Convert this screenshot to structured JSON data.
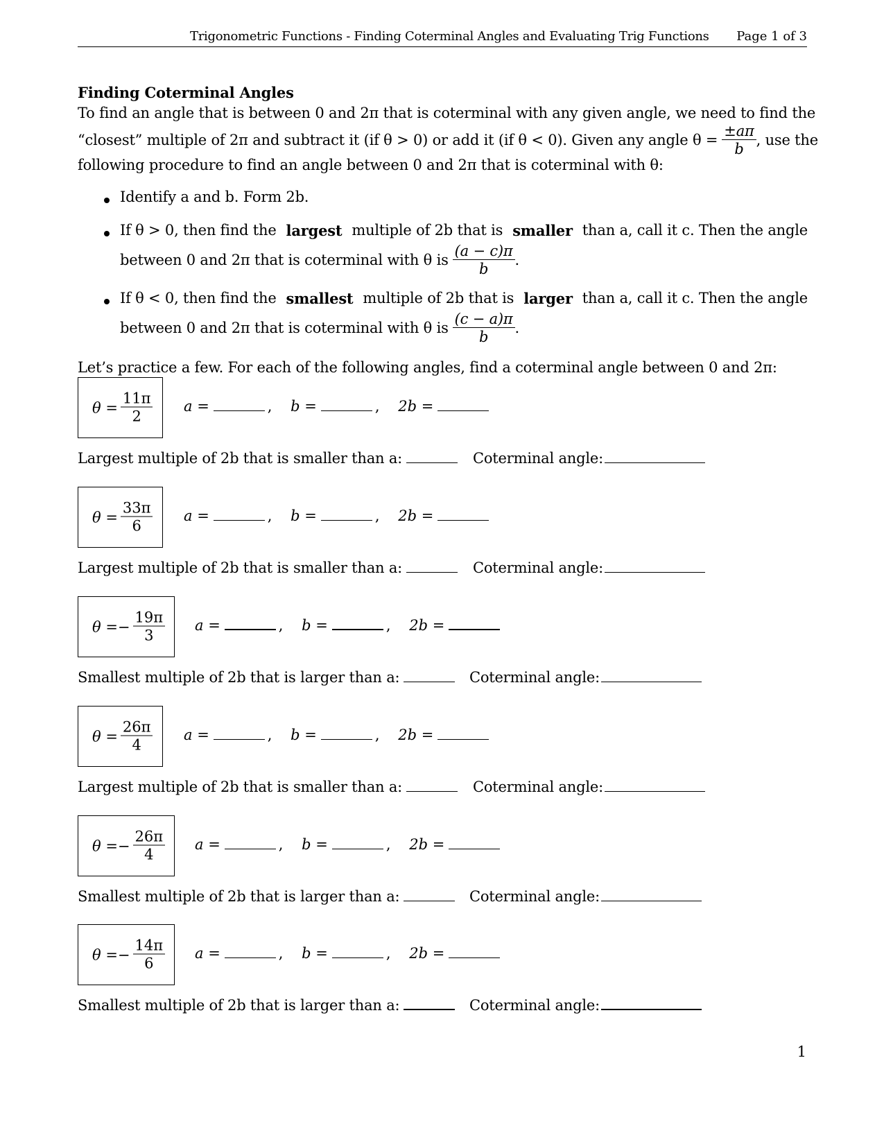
{
  "header": {
    "title": "Trigonometric Functions - Finding Coterminal Angles and Evaluating Trig Functions",
    "page": "Page 1 of 3"
  },
  "section": {
    "heading": "Finding Coterminal Angles",
    "intro_line1": "To find an angle that is between 0 and 2π that is coterminal with any given angle, we need to find the",
    "intro_line2_a": "“closest” multiple of 2π and subtract it (if θ > 0) or add it (if θ < 0). Given any angle θ =",
    "intro_frac_num": "±aπ",
    "intro_frac_den": "b",
    "intro_line2_b": ", use the",
    "intro_line3": "following procedure to find an angle between 0 and 2π that is coterminal with θ:",
    "bullets": [
      {
        "text": "Identify a and b. Form 2b."
      },
      {
        "pre": "If θ > 0, then find the",
        "bold1": "largest",
        "mid": "multiple of 2b that is",
        "bold2": "smaller",
        "post": "than a, call it c.  Then the angle",
        "line2": "between 0 and 2π that is coterminal with θ is",
        "frac_num": "(a − c)π",
        "frac_den": "b",
        "end": "."
      },
      {
        "pre": "If θ < 0, then find the",
        "bold1": "smallest",
        "mid": "multiple of 2b that is",
        "bold2": "larger",
        "post": "than a, call it c.  Then the angle",
        "line2": "between 0 and 2π that is coterminal with θ is",
        "frac_num": "(c − a)π",
        "frac_den": "b",
        "end": "."
      }
    ],
    "practice_intro": "Let’s practice a few. For each of the following angles, find a coterminal angle between 0 and 2π:"
  },
  "labels": {
    "theta_eq": "θ =",
    "neg_sign": "−",
    "a_eq": "a =",
    "b_eq": "b =",
    "twob_eq": "2b =",
    "comma": ",",
    "coterminal": "Coterminal angle:",
    "largest_prompt": "Largest multiple of 2b that is smaller than a:",
    "smallest_prompt": "Smallest multiple of 2b that is larger than a:"
  },
  "problems": [
    {
      "sign": "",
      "num": "11π",
      "den": "2",
      "prompt": "Largest multiple of 2b that is smaller than a:"
    },
    {
      "sign": "",
      "num": "33π",
      "den": "6",
      "prompt": "Largest multiple of 2b that is smaller than a:"
    },
    {
      "sign": "−",
      "num": "19π",
      "den": "3",
      "prompt": "Smallest multiple of 2b that is larger than a:"
    },
    {
      "sign": "",
      "num": "26π",
      "den": "4",
      "prompt": "Largest multiple of 2b that is smaller than a:"
    },
    {
      "sign": "−",
      "num": "26π",
      "den": "4",
      "prompt": "Smallest multiple of 2b that is larger than a:"
    },
    {
      "sign": "−",
      "num": "14π",
      "den": "6",
      "prompt": "Smallest multiple of 2b that is larger than a:"
    }
  ],
  "footer": {
    "page_number": "1"
  }
}
